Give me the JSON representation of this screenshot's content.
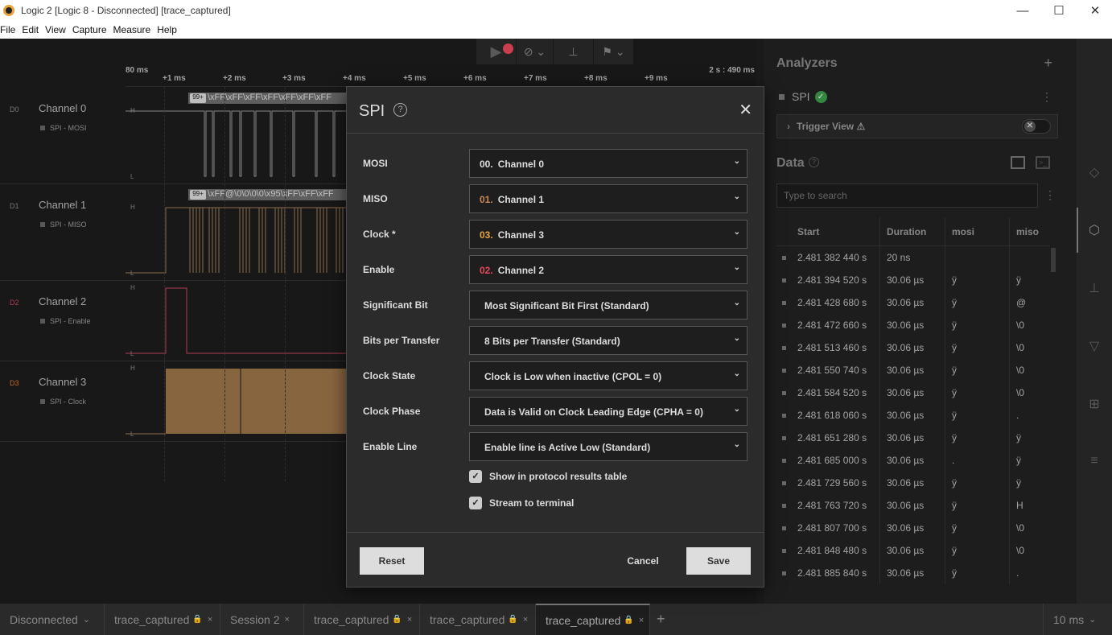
{
  "window": {
    "title": "Logic 2 [Logic 8 - Disconnected] [trace_captured]",
    "controls": {
      "minimize": "—",
      "maximize": "☐",
      "close": "✕"
    }
  },
  "menu": [
    "File",
    "Edit",
    "View",
    "Capture",
    "Measure",
    "Help"
  ],
  "ruler": {
    "start": "80 ms",
    "ticks": [
      "+1 ms",
      "+2 ms",
      "+3 ms",
      "+4 ms",
      "+5 ms",
      "+6 ms",
      "+7 ms",
      "+8 ms",
      "+9 ms"
    ],
    "end": "2 s : 490 ms"
  },
  "channels": [
    {
      "id": "D0",
      "name": "Channel 0",
      "analyzer": "SPI - MOSI",
      "color": "#9a9a9a",
      "bubble": "\\xFF\\xFF\\xFF\\xFF\\xFF\\xFF\\xFF"
    },
    {
      "id": "D1",
      "name": "Channel 1",
      "analyzer": "SPI - MISO",
      "color": "#a07a58",
      "bubble": "\\xFF@\\0\\0\\0\\0\\x95\\xFF\\xFF\\xFF"
    },
    {
      "id": "D2",
      "name": "Channel 2",
      "analyzer": "SPI - Enable",
      "color": "#c9455f",
      "bubble": ""
    },
    {
      "id": "D3",
      "name": "Channel 3",
      "analyzer": "SPI - Clock",
      "color": "#e07a2a",
      "bubble": ""
    }
  ],
  "bubble_count": "99+",
  "analyzers": {
    "title": "Analyzers",
    "add": "+",
    "items": [
      {
        "name": "SPI",
        "status": "✓"
      }
    ],
    "trigger_view": "Trigger View ⚠"
  },
  "data": {
    "title": "Data",
    "search_placeholder": "Type to search",
    "columns": [
      "Start",
      "Duration",
      "mosi",
      "miso"
    ],
    "rows": [
      [
        "2.481 382 440 s",
        "20 ns",
        "",
        ""
      ],
      [
        "2.481 394 520 s",
        "30.06 µs",
        "ÿ",
        "ÿ"
      ],
      [
        "2.481 428 680 s",
        "30.06 µs",
        "ÿ",
        "@"
      ],
      [
        "2.481 472 660 s",
        "30.06 µs",
        "ÿ",
        "\\0"
      ],
      [
        "2.481 513 460 s",
        "30.06 µs",
        "ÿ",
        "\\0"
      ],
      [
        "2.481 550 740 s",
        "30.06 µs",
        "ÿ",
        "\\0"
      ],
      [
        "2.481 584 520 s",
        "30.06 µs",
        "ÿ",
        "\\0"
      ],
      [
        "2.481 618 060 s",
        "30.06 µs",
        "ÿ",
        "."
      ],
      [
        "2.481 651 280 s",
        "30.06 µs",
        "ÿ",
        "ÿ"
      ],
      [
        "2.481 685 000 s",
        "30.06 µs",
        ".",
        "ÿ"
      ],
      [
        "2.481 729 560 s",
        "30.06 µs",
        "ÿ",
        "ÿ"
      ],
      [
        "2.481 763 720 s",
        "30.06 µs",
        "ÿ",
        "H"
      ],
      [
        "2.481 807 700 s",
        "30.06 µs",
        "ÿ",
        "\\0"
      ],
      [
        "2.481 848 480 s",
        "30.06 µs",
        "ÿ",
        "\\0"
      ],
      [
        "2.481 885 840 s",
        "30.06 µs",
        "ÿ",
        "."
      ]
    ]
  },
  "tabs": [
    {
      "label": "Disconnected",
      "suffix": "⌄"
    },
    {
      "label": "trace_captured",
      "lock": "🔒",
      "close": "×"
    },
    {
      "label": "Session 2",
      "close": "×"
    },
    {
      "label": "trace_captured",
      "lock": "🔒",
      "close": "×"
    },
    {
      "label": "trace_captured",
      "lock": "🔒",
      "close": "×"
    },
    {
      "label": "trace_captured",
      "lock": "🔒",
      "close": "×"
    }
  ],
  "tab_add": "+",
  "zoom": "10 ms",
  "modal": {
    "title": "SPI",
    "help": "?",
    "close": "✕",
    "fields": [
      {
        "label": "MOSI",
        "num": "00.",
        "num_color": "#dddddd",
        "value": "Channel 0"
      },
      {
        "label": "MISO",
        "num": "01.",
        "num_color": "#c98a55",
        "value": "Channel 1"
      },
      {
        "label": "Clock *",
        "num": "03.",
        "num_color": "#e8a33d",
        "value": "Channel 3"
      },
      {
        "label": "Enable",
        "num": "02.",
        "num_color": "#e8475b",
        "value": "Channel 2"
      },
      {
        "label": "Significant Bit",
        "num": "",
        "value": "Most Significant Bit First (Standard)"
      },
      {
        "label": "Bits per Transfer",
        "num": "",
        "value": "8 Bits per Transfer (Standard)"
      },
      {
        "label": "Clock State",
        "num": "",
        "value": "Clock is Low when inactive (CPOL = 0)"
      },
      {
        "label": "Clock Phase",
        "num": "",
        "value": "Data is Valid on Clock Leading Edge (CPHA = 0)"
      },
      {
        "label": "Enable Line",
        "num": "",
        "value": "Enable line is Active Low (Standard)"
      }
    ],
    "checkboxes": [
      {
        "label": "Show in protocol results table",
        "checked": true
      },
      {
        "label": "Stream to terminal",
        "checked": true
      }
    ],
    "reset": "Reset",
    "cancel": "Cancel",
    "save": "Save"
  }
}
